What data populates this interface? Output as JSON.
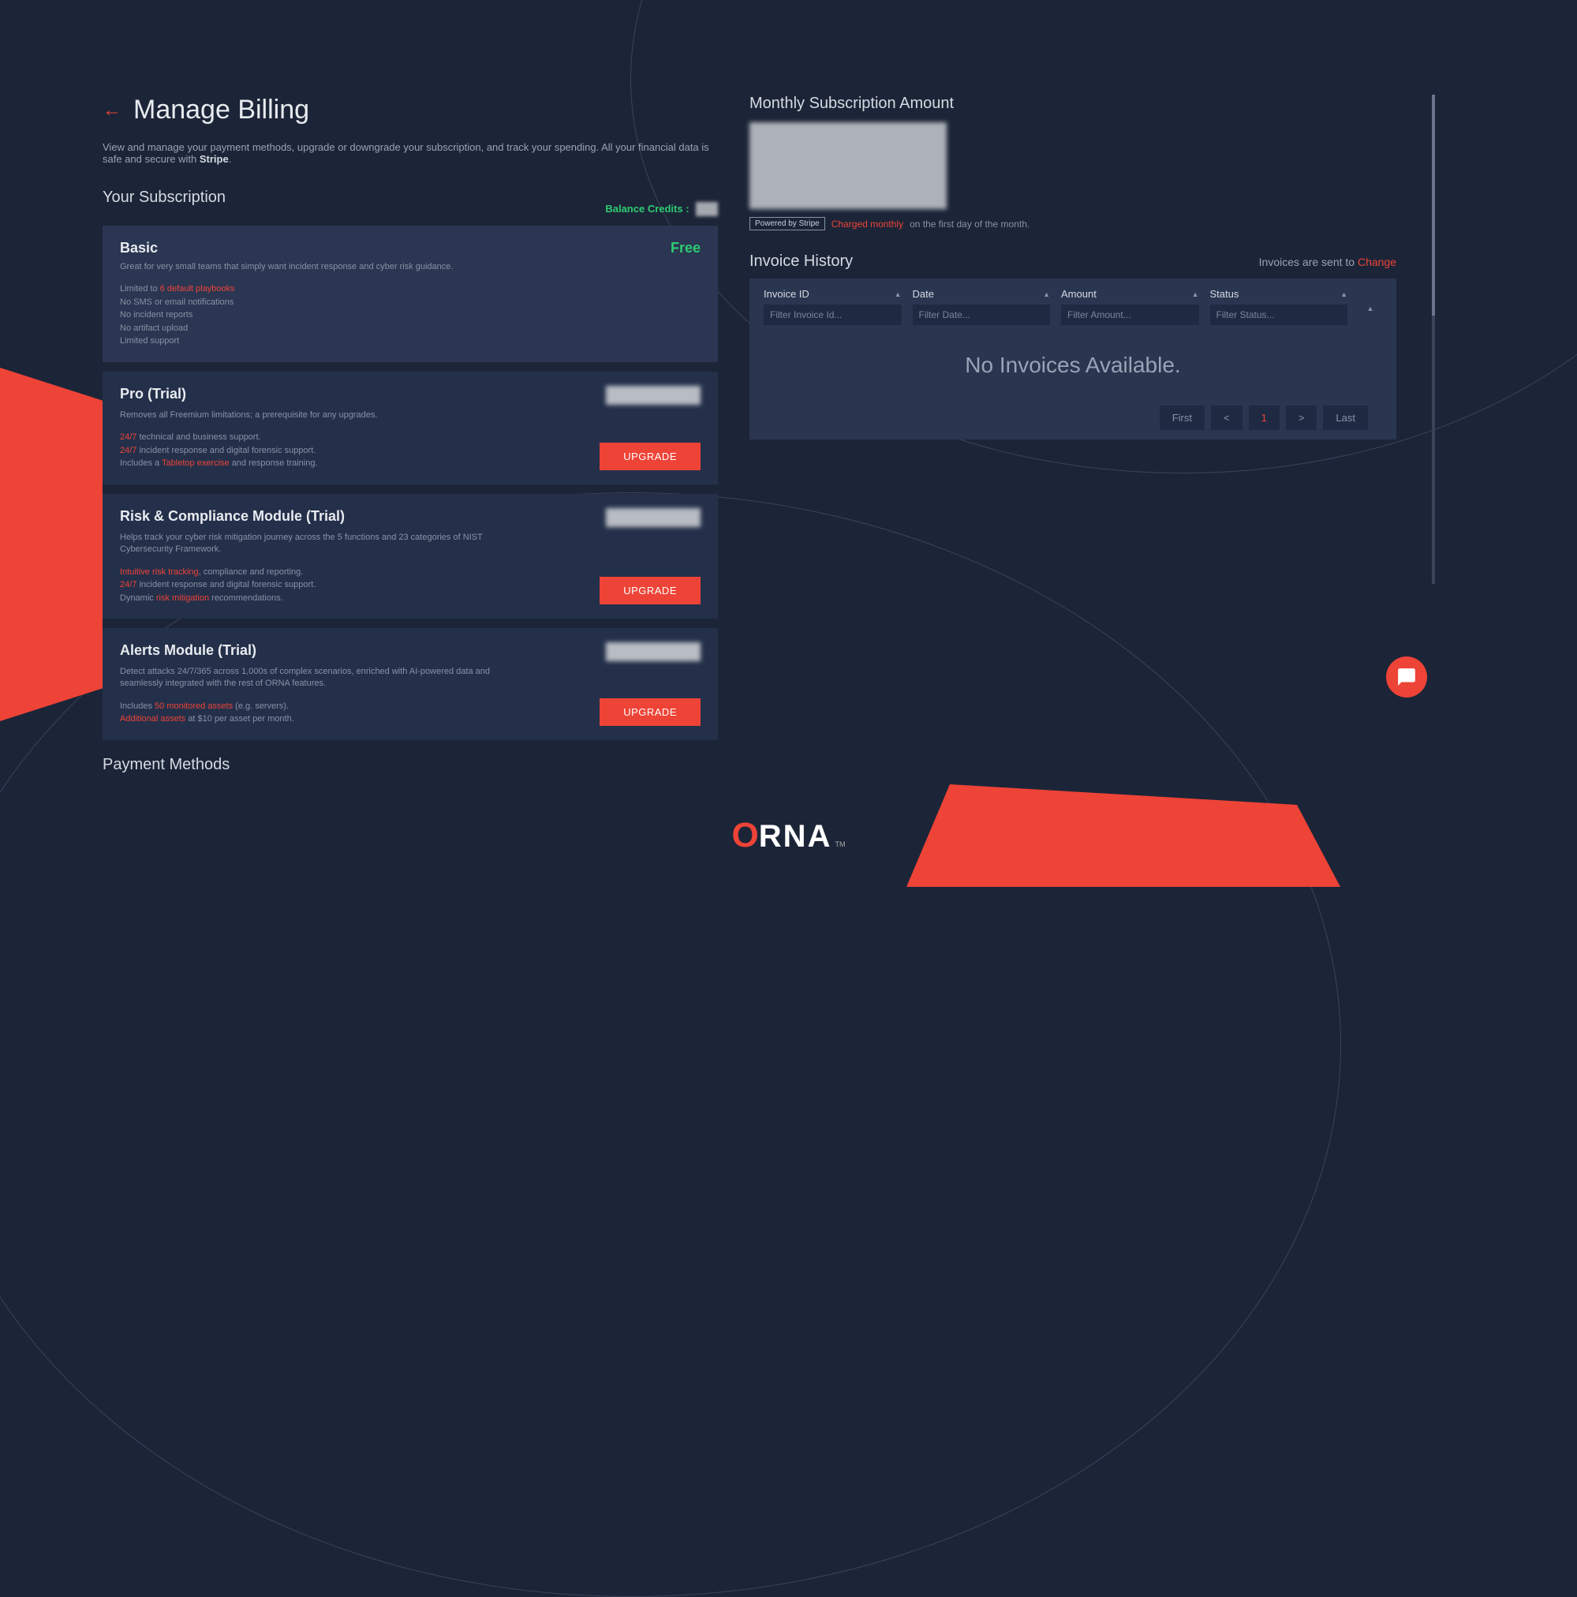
{
  "header": {
    "title": "Manage Billing",
    "description_prefix": "View and manage your payment methods, upgrade or downgrade your subscription, and track your spending. All your financial data is safe and secure with ",
    "description_bold": "Stripe",
    "description_suffix": "."
  },
  "subscription": {
    "title": "Your Subscription",
    "balance_label": "Balance Credits :",
    "plans": [
      {
        "name": "Basic",
        "price_label": "Free",
        "desc": "Great for very small teams that simply want incident response and cyber risk guidance.",
        "feat_limited_prefix": "Limited to ",
        "feat_limited_hl": "6 default playbooks",
        "feat2": "No SMS or email notifications",
        "feat3": "No incident reports",
        "feat4": "No artifact upload",
        "feat5": "Limited support"
      },
      {
        "name": "Pro (Trial)",
        "desc": "Removes all Freemium limitations; a prerequisite for any upgrades.",
        "f1_hl": "24/7",
        "f1_rest": " technical and business support.",
        "f2_hl": "24/7",
        "f2_rest": " incident response and digital forensic support.",
        "f3_prefix": "Includes a ",
        "f3_hl": "Tabletop exercise",
        "f3_rest": " and response training.",
        "upgrade": "UPGRADE"
      },
      {
        "name": "Risk & Compliance Module (Trial)",
        "desc": "Helps track your cyber risk mitigation journey across the 5 functions and 23 categories of NIST Cybersecurity Framework.",
        "f1_hl": "Intuitive risk tracking",
        "f1_rest": ", compliance and reporting.",
        "f2_hl": "24/7",
        "f2_rest": " incident response and digital forensic support.",
        "f3_prefix": "Dynamic ",
        "f3_hl": "risk mitigation",
        "f3_rest": " recommendations.",
        "upgrade": "UPGRADE"
      },
      {
        "name": "Alerts Module (Trial)",
        "desc": "Detect attacks 24/7/365 across 1,000s of complex scenarios, enriched with AI-powered data and seamlessly integrated with the rest of ORNA features.",
        "f1_prefix": "Includes ",
        "f1_hl": "50 monitored assets",
        "f1_rest": " (e.g. servers).",
        "f2_hl": "Additional assets",
        "f2_rest": " at $10 per asset per month.",
        "upgrade": "UPGRADE"
      }
    ]
  },
  "payment_methods": {
    "title": "Payment Methods"
  },
  "monthly": {
    "title": "Monthly Subscription Amount",
    "stripe_badge": "Powered by Stripe",
    "charged": "Charged monthly",
    "charged_rest": " on the first day of the month."
  },
  "invoices": {
    "title": "Invoice History",
    "sent_prefix": "Invoices are sent to ",
    "change": "Change",
    "columns": {
      "id": "Invoice ID",
      "date": "Date",
      "amount": "Amount",
      "status": "Status"
    },
    "filters": {
      "id": "Filter Invoice Id...",
      "date": "Filter Date...",
      "amount": "Filter Amount...",
      "status": "Filter Status..."
    },
    "empty": "No Invoices Available.",
    "pagination": {
      "first": "First",
      "prev": "<",
      "current": "1",
      "next": ">",
      "last": "Last"
    }
  },
  "logo": {
    "o": "O",
    "rest": "RNA",
    "tm": "TM"
  }
}
